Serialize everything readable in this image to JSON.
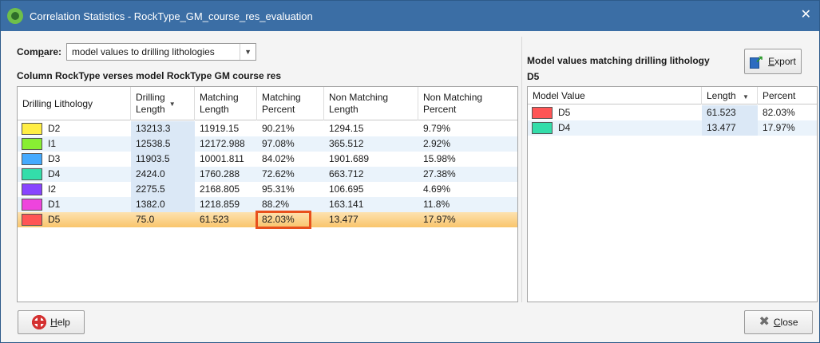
{
  "window": {
    "title": "Correlation Statistics - RockType_GM_course_res_evaluation",
    "close_glyph": "✕"
  },
  "compare": {
    "label_prefix": "Com",
    "label_underlined": "p",
    "label_suffix": "are:",
    "selected": "model values to drilling lithologies",
    "arrow": "▼"
  },
  "left": {
    "section_title": "Column RockType verses model RockType GM course res",
    "columns": [
      {
        "line1": "Drilling Lithology",
        "line2": ""
      },
      {
        "line1": "Drilling",
        "line2": "Length",
        "sorted": "▼"
      },
      {
        "line1": "Matching",
        "line2": "Length"
      },
      {
        "line1": "Matching",
        "line2": "Percent"
      },
      {
        "line1": "Non Matching",
        "line2": "Length"
      },
      {
        "line1": "Non Matching",
        "line2": "Percent"
      }
    ],
    "rows": [
      {
        "lith": "D2",
        "color": "#ffee44",
        "drilling_length": "13213.3",
        "matching_length": "11919.15",
        "matching_percent": "90.21%",
        "non_matching_length": "1294.15",
        "non_matching_percent": "9.79%"
      },
      {
        "lith": "I1",
        "color": "#88ee33",
        "drilling_length": "12538.5",
        "matching_length": "12172.988",
        "matching_percent": "97.08%",
        "non_matching_length": "365.512",
        "non_matching_percent": "2.92%"
      },
      {
        "lith": "D3",
        "color": "#44aaff",
        "drilling_length": "11903.5",
        "matching_length": "10001.811",
        "matching_percent": "84.02%",
        "non_matching_length": "1901.689",
        "non_matching_percent": "15.98%"
      },
      {
        "lith": "D4",
        "color": "#33ddaa",
        "drilling_length": "2424.0",
        "matching_length": "1760.288",
        "matching_percent": "72.62%",
        "non_matching_length": "663.712",
        "non_matching_percent": "27.38%"
      },
      {
        "lith": "I2",
        "color": "#8844ff",
        "drilling_length": "2275.5",
        "matching_length": "2168.805",
        "matching_percent": "95.31%",
        "non_matching_length": "106.695",
        "non_matching_percent": "4.69%"
      },
      {
        "lith": "D1",
        "color": "#ee44dd",
        "drilling_length": "1382.0",
        "matching_length": "1218.859",
        "matching_percent": "88.2%",
        "non_matching_length": "163.141",
        "non_matching_percent": "11.8%"
      },
      {
        "lith": "D5",
        "color": "#ff5555",
        "drilling_length": "75.0",
        "matching_length": "61.523",
        "matching_percent": "82.03%",
        "non_matching_length": "13.477",
        "non_matching_percent": "17.97%",
        "selected": true
      }
    ]
  },
  "right": {
    "title_line1": "Model values matching drilling lithology",
    "title_line2": "D5",
    "export_prefix": "",
    "export_underlined": "E",
    "export_suffix": "xport",
    "columns": [
      {
        "label": "Model Value"
      },
      {
        "label": "Length",
        "sorted": "▼"
      },
      {
        "label": "Percent"
      }
    ],
    "rows": [
      {
        "value": "D5",
        "color": "#ff5555",
        "length": "61.523",
        "percent": "82.03%"
      },
      {
        "value": "D4",
        "color": "#33ddaa",
        "length": "13.477",
        "percent": "17.97%"
      }
    ]
  },
  "buttons": {
    "help_underlined": "H",
    "help_suffix": "elp",
    "close_underlined": "C",
    "close_suffix": "lose"
  },
  "colors": {
    "titlebar": "#3b6ea5",
    "selection": "#f9c56c",
    "highlight_box": "#e8501c"
  }
}
